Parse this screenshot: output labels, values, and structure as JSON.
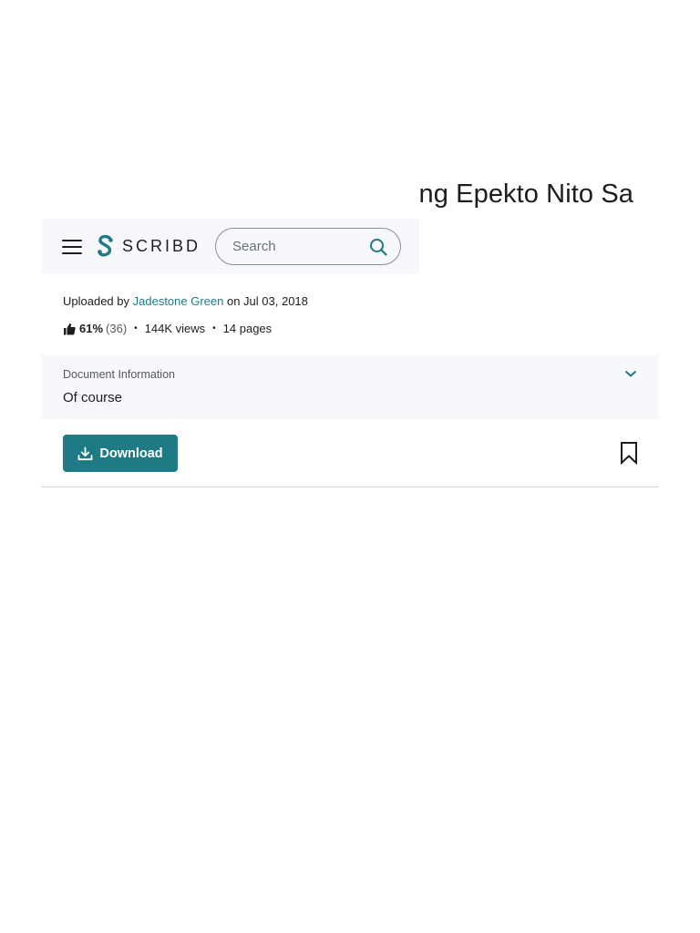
{
  "document": {
    "title_partial": "ng Epekto Nito Sa"
  },
  "header": {
    "logo_text": "SCRIBD",
    "search_placeholder": "Search"
  },
  "upload": {
    "prefix": "Uploaded by",
    "author": "Jadestone Green",
    "date_text": "on Jul 03, 2018"
  },
  "stats": {
    "rating": "61%",
    "rating_count": "(36)",
    "views": "144K views",
    "pages": "14 pages"
  },
  "doc_info": {
    "label": "Document Information",
    "value": "Of course"
  },
  "actions": {
    "download_label": "Download"
  },
  "colors": {
    "accent": "#1e7b85",
    "panel_bg": "#f6f8fc",
    "text": "#1c1d1f"
  },
  "icons": {
    "menu": "hamburger-menu-icon",
    "logo": "scribd-logo-icon",
    "search": "search-icon",
    "thumbs_up": "thumbs-up-icon",
    "chevron": "chevron-down-icon",
    "download": "download-icon",
    "bookmark": "bookmark-icon"
  }
}
